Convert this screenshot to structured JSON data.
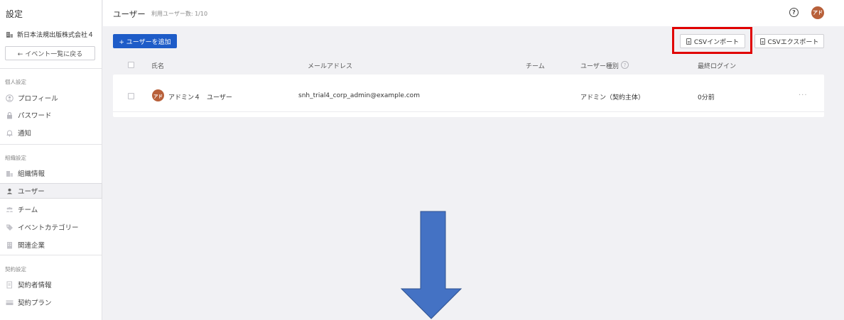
{
  "sidebar": {
    "title": "設定",
    "org_name": "新日本法規出版株式会社４",
    "back_label": "← イベント一覧に戻る",
    "sections": [
      {
        "label": "個人設定",
        "items": [
          {
            "label": "プロフィール",
            "icon": "profile-icon"
          },
          {
            "label": "パスワード",
            "icon": "lock-icon"
          },
          {
            "label": "通知",
            "icon": "bell-icon"
          }
        ]
      },
      {
        "label": "組織設定",
        "items": [
          {
            "label": "組織情報",
            "icon": "building-icon"
          },
          {
            "label": "ユーザー",
            "icon": "user-icon",
            "active": true
          },
          {
            "label": "チーム",
            "icon": "team-icon"
          },
          {
            "label": "イベントカテゴリー",
            "icon": "tag-icon"
          },
          {
            "label": "関連企業",
            "icon": "company-icon"
          }
        ]
      },
      {
        "label": "契約設定",
        "items": [
          {
            "label": "契約者情報",
            "icon": "contract-doc-icon"
          },
          {
            "label": "契約プラン",
            "icon": "card-icon"
          }
        ]
      }
    ]
  },
  "header": {
    "title": "ユーザー",
    "user_count": "利用ユーザー数: 1/10",
    "avatar_text": "アド"
  },
  "toolbar": {
    "add_user": "+ ユーザーを追加",
    "csv_import": "CSVインポート",
    "csv_export": "CSVエクスポート"
  },
  "table": {
    "columns": {
      "name": "氏名",
      "email": "メールアドレス",
      "team": "チーム",
      "user_type": "ユーザー種別",
      "last_login": "最終ログイン"
    },
    "rows": [
      {
        "avatar_text": "アド",
        "name": "アドミン４　ユーザー",
        "email": "snh_trial4_corp_admin@example.com",
        "team": "",
        "user_type": "アドミン（契約主体）",
        "last_login": "0分前",
        "more": "···"
      }
    ]
  },
  "colors": {
    "primary": "#1e5cc8",
    "avatar": "#b8603a",
    "highlight": "#e00000",
    "arrow_fill": "#4472c4",
    "arrow_stroke": "#2f528f"
  }
}
